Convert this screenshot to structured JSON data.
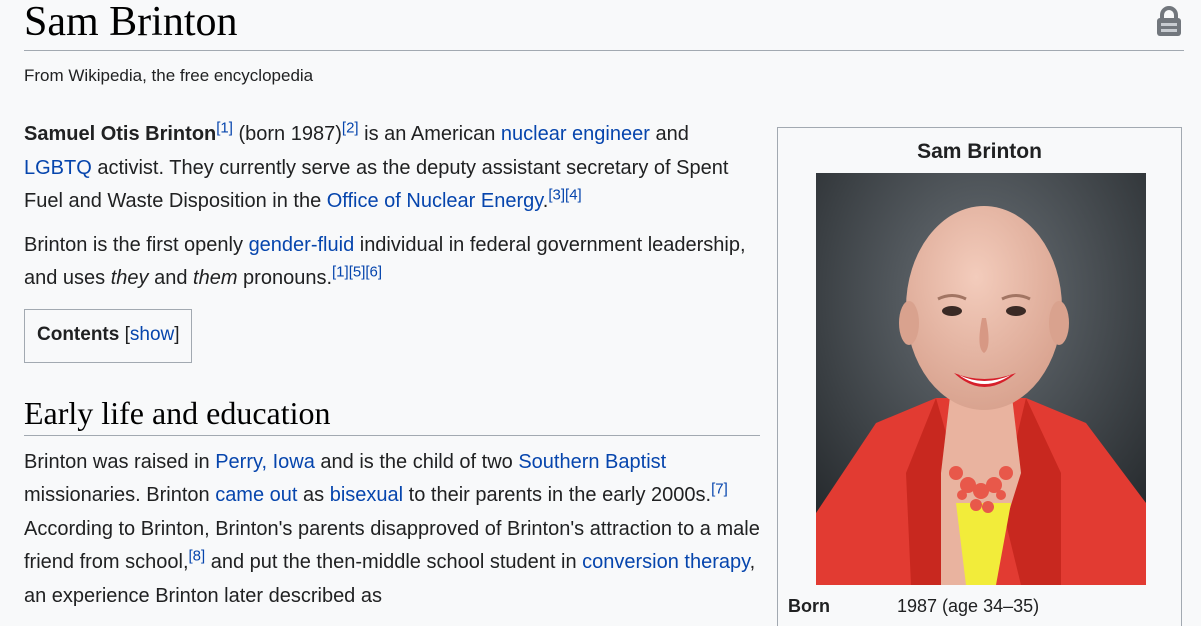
{
  "header": {
    "title": "Sam Brinton",
    "tagline": "From Wikipedia, the free encyclopedia",
    "protection_icon": "lock-icon"
  },
  "intro": {
    "p1": {
      "name": "Samuel Otis Brinton",
      "ref1": "[1]",
      "text1": " (born 1987)",
      "ref2": "[2]",
      "text2": " is an American ",
      "link_nuclear_engineer": "nuclear engineer",
      "text3": " and ",
      "link_lgbtq": "LGBTQ",
      "text4": " activist. They currently serve as the deputy assistant secretary of Spent Fuel and Waste Disposition in the ",
      "link_office": "Office of Nuclear Energy",
      "text5": ".",
      "ref3": "[3]",
      "ref4": "[4]"
    },
    "p2": {
      "text1": "Brinton is the first openly ",
      "link_gender_fluid": "gender-fluid",
      "text2": " individual in federal government leadership, and uses ",
      "em_they": "they",
      "text3": " and ",
      "em_them": "them",
      "text4": " pronouns.",
      "ref1": "[1]",
      "ref5": "[5]",
      "ref6": "[6]"
    }
  },
  "toc": {
    "label": "Contents",
    "open_bracket": "[",
    "show": "show",
    "close_bracket": "]"
  },
  "section_early_life": {
    "heading": "Early life and education",
    "text1": "Brinton was raised in ",
    "link_perry": "Perry, Iowa",
    "text2": " and is the child of two ",
    "link_baptist": "Southern Baptist",
    "text3": " missionaries. Brinton ",
    "link_came_out": "came out",
    "text4": " as ",
    "link_bisexual": "bisexual",
    "text5": " to their parents in the early 2000s.",
    "ref7": "[7]",
    "text6": " According to Brinton, Brinton's parents disapproved of Brinton's attraction to a male friend from school,",
    "ref8": "[8]",
    "text7": " and put the then-middle school student in ",
    "link_conversion": "conversion therapy",
    "text8": ", an experience Brinton later described as"
  },
  "infobox": {
    "title": "Sam Brinton",
    "born_label": "Born",
    "born_value": "1987 (age 34–35)"
  },
  "colors": {
    "link": "#0645ad",
    "text": "#202122",
    "border": "#a2a9b1",
    "background": "#f8f9fa"
  }
}
